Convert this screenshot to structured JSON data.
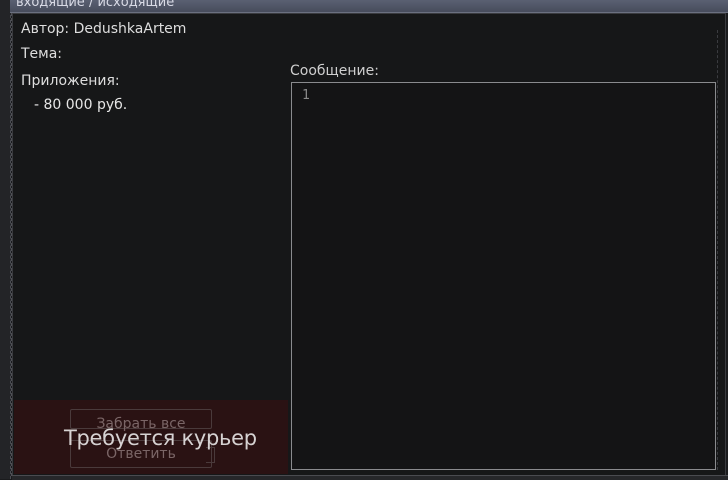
{
  "window": {
    "title": "входящие / исходящие"
  },
  "mail": {
    "author_line": "Автор: DedushkaArtem",
    "subject_line": "Тема:",
    "attachments_label": "Приложения:",
    "attachments": [
      "- 80 000 руб."
    ]
  },
  "message": {
    "label": "Сообщение:",
    "line_number": "1",
    "body": ""
  },
  "actions": {
    "take_all_label": "Забрать все",
    "reply_label": "Ответить",
    "courier_required": "Требуется курьер"
  },
  "colors": {
    "background": "#1a1b1d",
    "panel": "#161718",
    "courier_overlay": "#2a1213",
    "message_border": "#8a8b8e"
  }
}
